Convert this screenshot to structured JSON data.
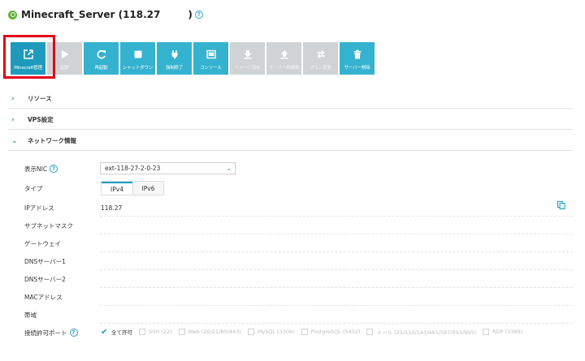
{
  "header": {
    "title": "Minecraft_Server (118.27",
    "title_suffix": ")",
    "help_glyph": "?",
    "status_color": "#5fb336"
  },
  "toolbar": {
    "active_color": "#1e9bbc",
    "enabled_color": "#35b2cf",
    "disabled_color": "#cfd3d6",
    "buttons": [
      {
        "label": "Minecraft管理",
        "icon": "external-link-icon",
        "state": "active"
      },
      {
        "label": "起動",
        "icon": "play-icon",
        "state": "disabled"
      },
      {
        "label": "再起動",
        "icon": "refresh-icon",
        "state": "enabled"
      },
      {
        "label": "シャットダウン",
        "icon": "stop-icon",
        "state": "enabled"
      },
      {
        "label": "強制終了",
        "icon": "plug-icon",
        "state": "enabled"
      },
      {
        "label": "コンソール",
        "icon": "console-icon",
        "state": "enabled"
      },
      {
        "label": "イメージ保存",
        "icon": "save-image-icon",
        "state": "disabled"
      },
      {
        "label": "サーバー再構築",
        "icon": "rebuild-icon",
        "state": "disabled"
      },
      {
        "label": "プラン変更",
        "icon": "swap-icon",
        "state": "disabled"
      },
      {
        "label": "サーバー削除",
        "icon": "trash-icon",
        "state": "enabled"
      }
    ]
  },
  "sections": {
    "resource": {
      "label": "リソース",
      "chevron": "›"
    },
    "vps": {
      "label": "VPS設定",
      "chevron": "›"
    },
    "network": {
      "label": "ネットワーク情報",
      "chevron": "⌄"
    }
  },
  "network": {
    "nic_label": "表示NIC",
    "nic_value": "ext-118-27-2-0-23",
    "type_label": "タイプ",
    "type_tabs": [
      "IPv4",
      "IPv6"
    ],
    "ip_label": "IPアドレス",
    "ip_value": "118.27",
    "subnet_label": "サブネットマスク",
    "gateway_label": "ゲートウェイ",
    "dns1_label": "DNSサーバー1",
    "dns2_label": "DNSサーバー2",
    "mac_label": "MACアドレス",
    "band_label": "帯域",
    "ports_label": "接続許可ポート",
    "ports": {
      "all": "全て許可",
      "check_glyph": "✔",
      "items": [
        "SSH (22)",
        "Web (20/21/80/443)",
        "MySQL (3306)",
        "PostgreSQL (5432)",
        "メール (25/110/143/465/587/993/995)",
        "RDP (3389)"
      ]
    }
  }
}
